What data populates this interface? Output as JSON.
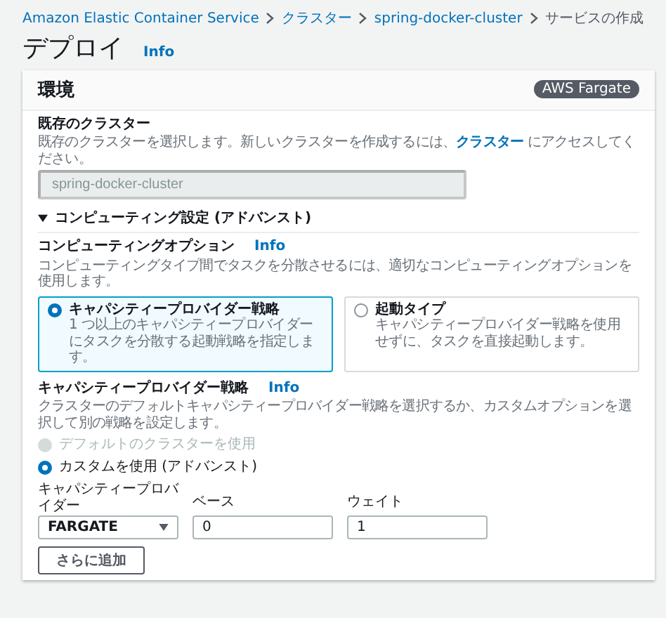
{
  "breadcrumb": [
    {
      "label": "Amazon Elastic Container Service",
      "link": true
    },
    {
      "label": "クラスター",
      "link": true
    },
    {
      "label": "spring-docker-cluster",
      "link": true
    },
    {
      "label": "サービスの作成",
      "link": false
    }
  ],
  "page": {
    "title": "デプロイ",
    "info": "Info"
  },
  "card": {
    "title": "環境",
    "badge": "AWS Fargate",
    "existing_cluster": {
      "label": "既存のクラスター",
      "description_before": "既存のクラスターを選択します。新しいクラスターを作成するには、",
      "description_link": "クラスター",
      "description_after": " にアクセスしてください。",
      "value": "spring-docker-cluster",
      "disabled": true
    },
    "expander": {
      "label": "コンピューティング設定 (アドバンスト)",
      "expanded": true
    },
    "compute_options": {
      "label": "コンピューティングオプション",
      "info": "Info",
      "description": "コンピューティングタイプ間でタスクを分散させるには、適切なコンピューティングオプションを使用します。",
      "tiles": [
        {
          "title": "キャパシティープロバイダー戦略",
          "description": "1 つ以上のキャパシティープロバイダーにタスクを分散する起動戦略を指定します。",
          "selected": true
        },
        {
          "title": "起動タイプ",
          "description": "キャパシティープロバイダー戦略を使用せずに、タスクを直接起動します。",
          "selected": false
        }
      ]
    },
    "strategy": {
      "label": "キャパシティープロバイダー戦略",
      "info": "Info",
      "description": "クラスターのデフォルトキャパシティープロバイダー戦略を選択するか、カスタムオプションを選択して別の戦略を設定します。",
      "options": [
        {
          "label": "デフォルトのクラスターを使用",
          "selected": false,
          "disabled": true
        },
        {
          "label": "カスタムを使用 (アドバンスト)",
          "selected": true,
          "disabled": false
        }
      ]
    },
    "provider": {
      "label": "キャパシティープロバイダー",
      "value": "FARGATE"
    },
    "base": {
      "label": "ベース",
      "value": "0"
    },
    "weight": {
      "label": "ウェイト",
      "value": "1"
    },
    "add_button": "さらに追加"
  }
}
